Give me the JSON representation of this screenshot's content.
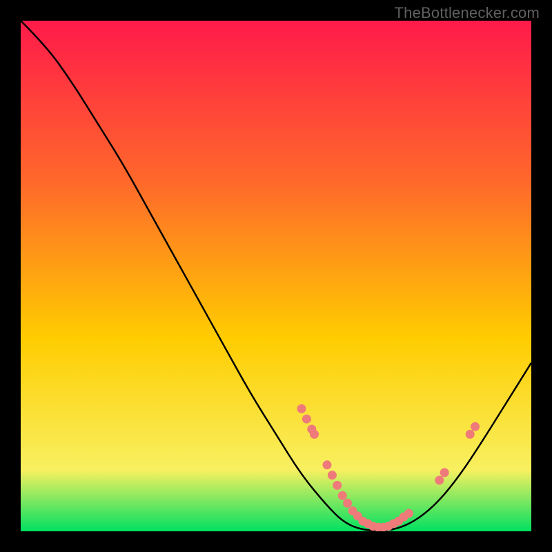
{
  "attribution": "TheBottlenecker.com",
  "chart_data": {
    "type": "line",
    "title": "",
    "xlabel": "",
    "ylabel": "",
    "xlim": [
      0,
      100
    ],
    "ylim": [
      0,
      100
    ],
    "grid": false,
    "curve": [
      {
        "x": 0,
        "y": 100
      },
      {
        "x": 5,
        "y": 95
      },
      {
        "x": 10,
        "y": 88
      },
      {
        "x": 15,
        "y": 80
      },
      {
        "x": 20,
        "y": 72
      },
      {
        "x": 25,
        "y": 63
      },
      {
        "x": 30,
        "y": 54
      },
      {
        "x": 35,
        "y": 45
      },
      {
        "x": 40,
        "y": 36
      },
      {
        "x": 45,
        "y": 27
      },
      {
        "x": 50,
        "y": 19
      },
      {
        "x": 55,
        "y": 11
      },
      {
        "x": 60,
        "y": 5
      },
      {
        "x": 63,
        "y": 2
      },
      {
        "x": 66,
        "y": 0.5
      },
      {
        "x": 70,
        "y": 0
      },
      {
        "x": 74,
        "y": 0.5
      },
      {
        "x": 78,
        "y": 2.5
      },
      {
        "x": 82,
        "y": 6
      },
      {
        "x": 86,
        "y": 11
      },
      {
        "x": 90,
        "y": 17
      },
      {
        "x": 95,
        "y": 25
      },
      {
        "x": 100,
        "y": 33
      }
    ],
    "markers": [
      {
        "x": 55,
        "y": 24
      },
      {
        "x": 56,
        "y": 22
      },
      {
        "x": 57,
        "y": 20
      },
      {
        "x": 57.5,
        "y": 19
      },
      {
        "x": 60,
        "y": 13
      },
      {
        "x": 61,
        "y": 11
      },
      {
        "x": 62,
        "y": 9
      },
      {
        "x": 63,
        "y": 7
      },
      {
        "x": 64,
        "y": 5.5
      },
      {
        "x": 65,
        "y": 4
      },
      {
        "x": 66,
        "y": 3
      },
      {
        "x": 67,
        "y": 2
      },
      {
        "x": 68,
        "y": 1.5
      },
      {
        "x": 69,
        "y": 1
      },
      {
        "x": 70,
        "y": 0.8
      },
      {
        "x": 71,
        "y": 0.8
      },
      {
        "x": 72,
        "y": 1
      },
      {
        "x": 73,
        "y": 1.5
      },
      {
        "x": 74,
        "y": 2
      },
      {
        "x": 75,
        "y": 2.8
      },
      {
        "x": 76,
        "y": 3.5
      },
      {
        "x": 82,
        "y": 10
      },
      {
        "x": 83,
        "y": 11.5
      },
      {
        "x": 88,
        "y": 19
      },
      {
        "x": 89,
        "y": 20.5
      }
    ],
    "background_gradient": {
      "top": "#ff1a4a",
      "mid_upper": "#ff6a2a",
      "mid": "#ffcc00",
      "mid_lower": "#f8f060",
      "bottom": "#00e060"
    },
    "marker_color": "#ef7a7a",
    "curve_color": "#000000"
  }
}
